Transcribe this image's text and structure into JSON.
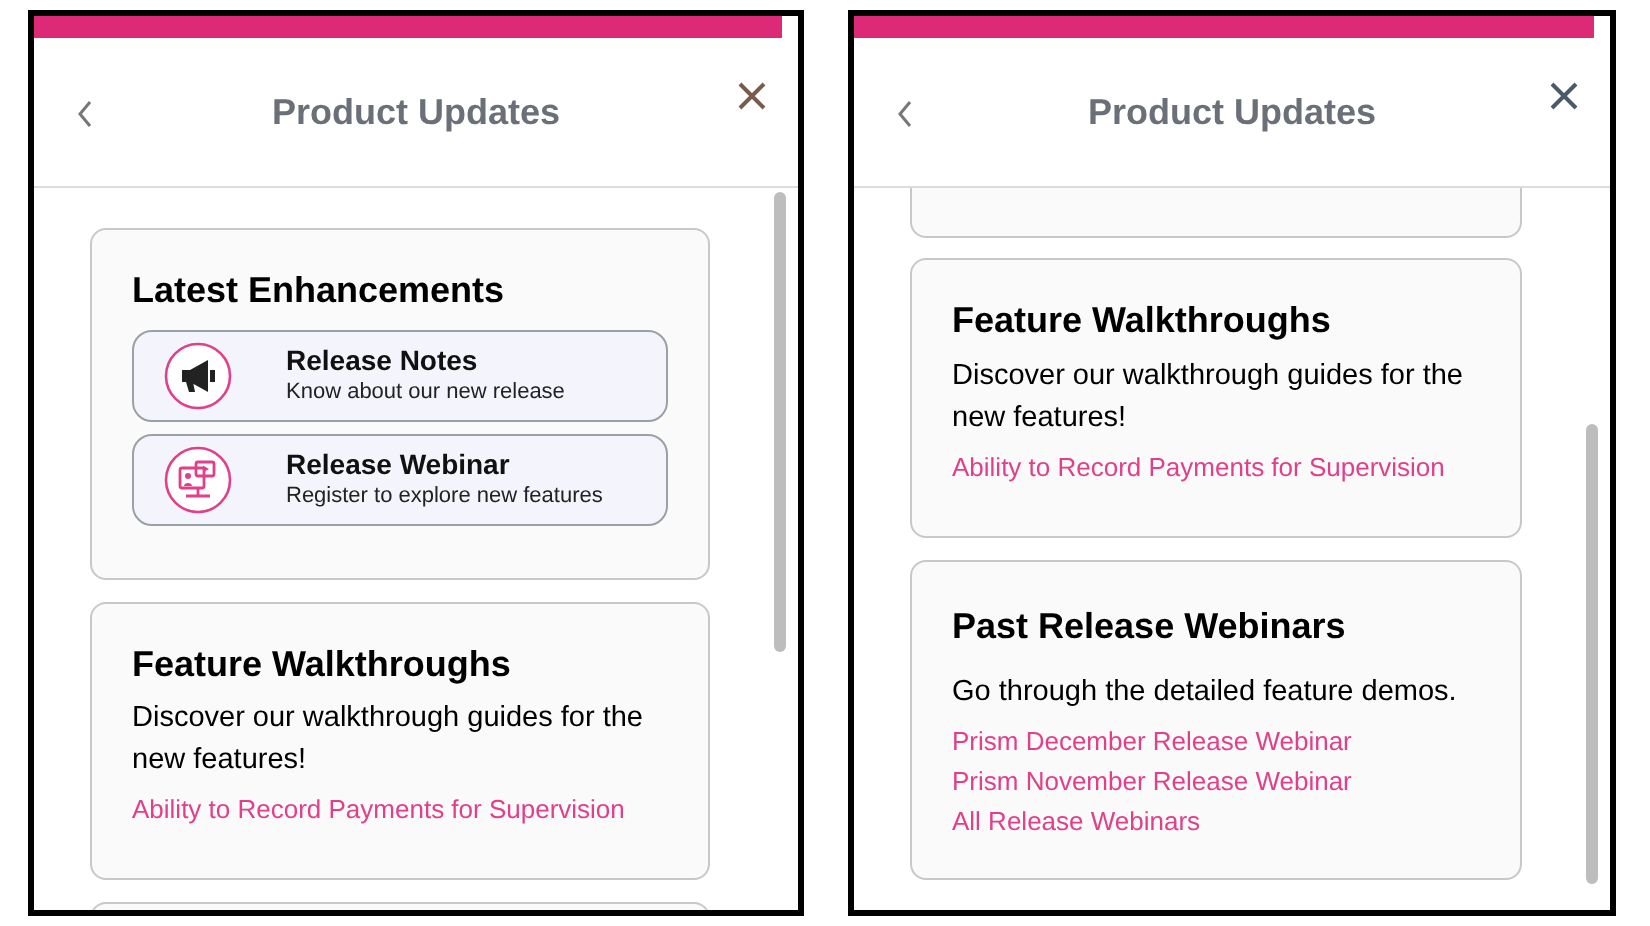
{
  "panels": [
    {
      "header": {
        "title": "Product Updates"
      },
      "cards": [
        {
          "kind": "enhancements",
          "title": "Latest Enhancements",
          "items": [
            {
              "kind": "notes",
              "title": "Release Notes",
              "subtitle": "Know about our new release"
            },
            {
              "kind": "webinar",
              "title": "Release Webinar",
              "subtitle": "Register to explore new features"
            }
          ]
        },
        {
          "kind": "walkthroughs",
          "title": "Feature Walkthroughs",
          "text": "Discover our walkthrough guides for the new features!",
          "links": [
            "Ability to Record Payments for Supervision"
          ]
        },
        {
          "kind": "clipped-top"
        }
      ]
    },
    {
      "header": {
        "title": "Product Updates"
      },
      "cards": [
        {
          "kind": "clipped-bottom"
        },
        {
          "kind": "walkthroughs",
          "title": "Feature Walkthroughs",
          "text": "Discover our walkthrough guides for the new features!",
          "links": [
            "Ability to Record Payments for Supervision"
          ]
        },
        {
          "kind": "webinars",
          "title": "Past Release Webinars",
          "text": "Go through the detailed feature demos.",
          "links": [
            "Prism December Release Webinar",
            "Prism November Release Webinar",
            "All Release Webinars"
          ]
        }
      ]
    }
  ]
}
